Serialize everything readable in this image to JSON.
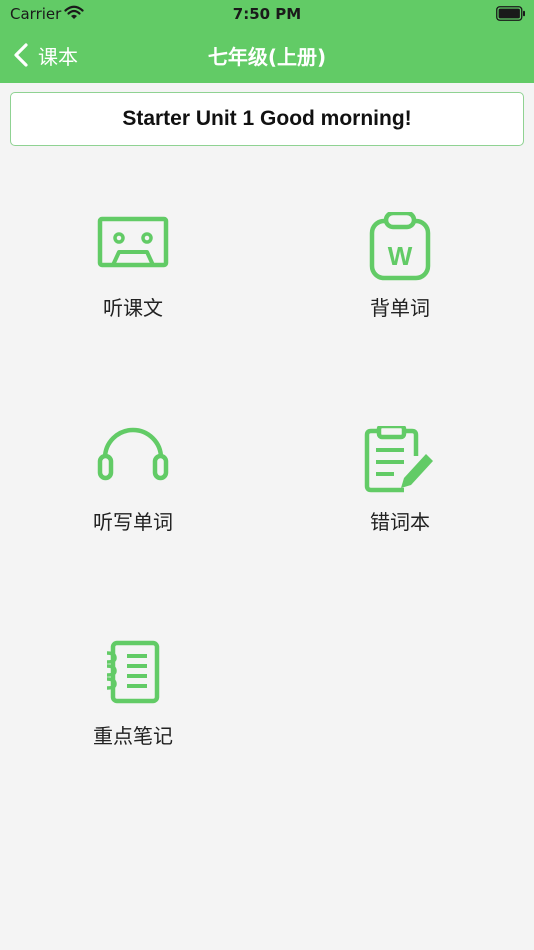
{
  "status_bar": {
    "carrier": "Carrier",
    "time": "7:50 PM"
  },
  "nav": {
    "back_label": "课本",
    "title": "七年级(上册)"
  },
  "unit": {
    "title": "Starter Unit 1 Good morning!"
  },
  "features": [
    {
      "label": "听课文",
      "icon": "cassette-tape-icon"
    },
    {
      "label": "背单词",
      "icon": "word-clipboard-icon"
    },
    {
      "label": "听写单词",
      "icon": "headphones-icon"
    },
    {
      "label": "错词本",
      "icon": "clipboard-pencil-icon"
    },
    {
      "label": "重点笔记",
      "icon": "notebook-icon"
    }
  ],
  "colors": {
    "accent": "#62cb66",
    "background": "#f4f4f4"
  }
}
